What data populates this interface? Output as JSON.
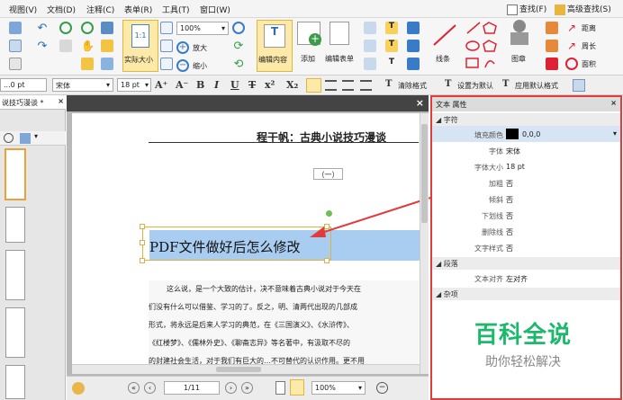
{
  "menu": [
    "视图(V)",
    "文档(D)",
    "注释(C)",
    "表单(R)",
    "工具(T)",
    "窗口(W)"
  ],
  "menu_right": {
    "find": "查找(F)",
    "advanced_find": "高级查找(S)"
  },
  "ribbon": {
    "actual_size": "实际大小",
    "zoom_value": "100%",
    "zoom_in": "放大",
    "zoom_out": "缩小",
    "edit_content": "编辑内容",
    "add": "添加",
    "edit_form": "编辑表单",
    "lines": "线条",
    "stamp": "图章",
    "distance": "距离",
    "perimeter": "周长",
    "area": "面积"
  },
  "format_bar": {
    "size": "...0 pt",
    "font": "宋体",
    "font_size": "18 pt",
    "clear_format": "清除格式",
    "set_default": "设置为默认",
    "apply_default": "应用默认格式"
  },
  "left_panel": {
    "tab": "说技巧漫谈 *"
  },
  "document": {
    "header": "程干帆：古典小说技巧漫谈",
    "section": "（一）",
    "selected_text": "PDF文件做好后怎么修改",
    "body_lines": [
      "这么说，是一个大致的估计，决不意味着古典小说对于今天在",
      "们没有什么可以借鉴、学习的了。反之，明、清两代出现的几部成",
      "形式，将永远是后来人学习的典范，在《三国演义》、《水浒传》、",
      "《红楼梦》、《儒林外史》、《聊斋志异》等名著中，有汲取不尽的",
      "的封建社会生活，对于我们有巨大的…不可替代的认识作用。更不用"
    ]
  },
  "status": {
    "page": "1/11",
    "zoom": "100%"
  },
  "props": {
    "title": "文本 属性",
    "sections": {
      "char": "字符",
      "para": "段落",
      "misc": "杂项"
    },
    "rows": [
      {
        "label": "填充颜色",
        "value": "0,0,0"
      },
      {
        "label": "字体",
        "value": "宋体"
      },
      {
        "label": "字体大小",
        "value": "18 pt"
      },
      {
        "label": "加粗",
        "value": "否"
      },
      {
        "label": "倾斜",
        "value": "否"
      },
      {
        "label": "下划线",
        "value": "否"
      },
      {
        "label": "删除线",
        "value": "否"
      },
      {
        "label": "文字样式",
        "value": "否"
      }
    ],
    "para_rows": [
      {
        "label": "文本对齐",
        "value": "左对齐"
      }
    ]
  },
  "watermark": {
    "title": "百科全说",
    "subtitle": "助你轻松解决"
  },
  "colors": {
    "accent": "#e33a3a",
    "selection": "#a9cdf0",
    "watermark": "#1cb86c"
  }
}
